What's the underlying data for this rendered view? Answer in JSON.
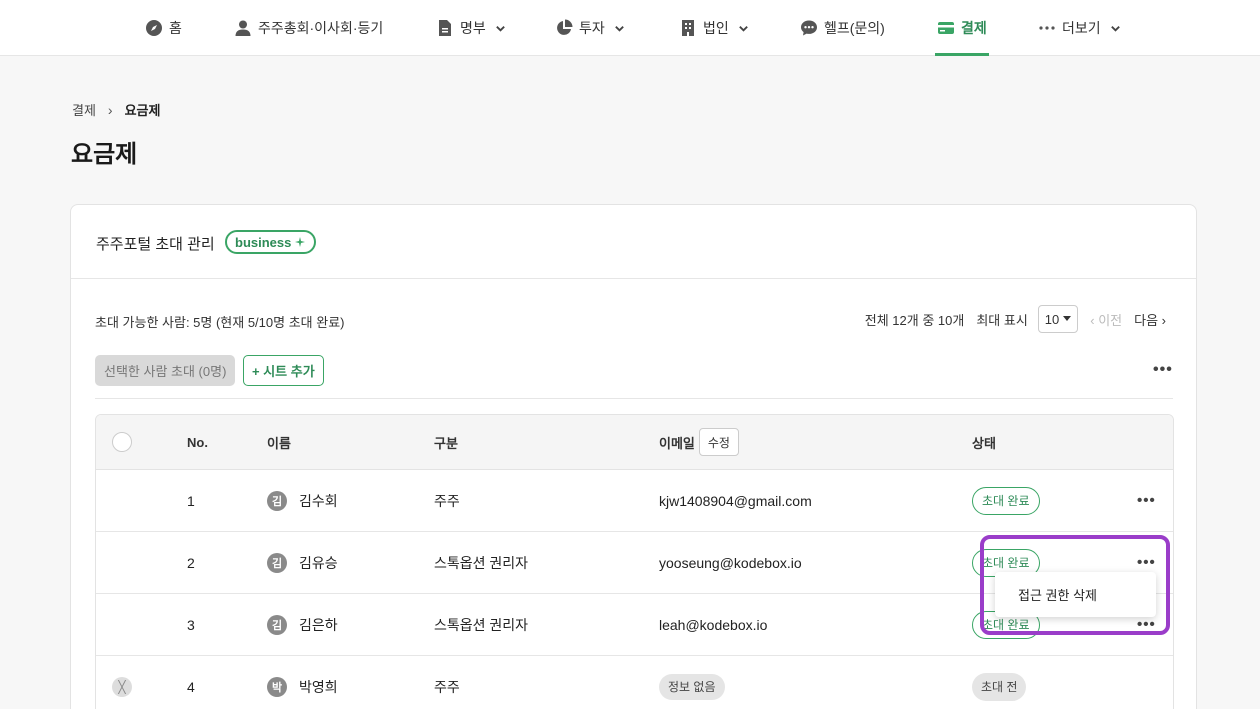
{
  "nav": {
    "items": [
      {
        "label": "홈",
        "icon": "compass-icon"
      },
      {
        "label": "주주총회·이사회·등기",
        "icon": "person-icon"
      },
      {
        "label": "명부",
        "icon": "document-icon"
      },
      {
        "label": "투자",
        "icon": "pie-chart-icon"
      },
      {
        "label": "법인",
        "icon": "building-icon"
      },
      {
        "label": "헬프(문의)",
        "icon": "chat-icon"
      },
      {
        "label": "결제",
        "icon": "card-icon"
      },
      {
        "label": "더보기",
        "icon": "more-dots-icon"
      }
    ],
    "active": "결제",
    "accent_color": "#3aa565"
  },
  "breadcrumb": {
    "parent": "결제",
    "separator": "›",
    "current": "요금제"
  },
  "page_title": "요금제",
  "card": {
    "title": "주주포털 초대 관리",
    "badge": "business"
  },
  "invite_info": "초대 가능한 사람: 5명 (현재 5/10명 초대 완료)",
  "pager": {
    "summary": "전체 12개 중 10개",
    "max_label": "최대 표시",
    "page_size": "10",
    "prev": "‹ 이전",
    "next": "다음 ›"
  },
  "toolbar": {
    "invite_button": "선택한 사람 초대 (0명)",
    "add_sheet_button": "+ 시트 추가",
    "more": "•••"
  },
  "table": {
    "headers": {
      "no": "No.",
      "name": "이름",
      "type": "구분",
      "email": "이메일",
      "edit": "수정",
      "status": "상태"
    },
    "rows": [
      {
        "no": "1",
        "initial": "김",
        "name": "김수회",
        "type": "주주",
        "email": "kjw1408904@gmail.com",
        "status": "초대 완료",
        "more": "•••"
      },
      {
        "no": "2",
        "initial": "김",
        "name": "김유승",
        "type": "스톡옵션 권리자",
        "email": "yooseung@kodebox.io",
        "status": "초대 완료",
        "more": "•••"
      },
      {
        "no": "3",
        "initial": "김",
        "name": "김은하",
        "type": "스톡옵션 권리자",
        "email": "leah@kodebox.io",
        "status": "초대 완료",
        "more": "•••"
      },
      {
        "no": "4",
        "initial": "박",
        "name": "박영희",
        "type": "주주",
        "email": "정보 없음",
        "status": "초대 전",
        "checkbox": "╳"
      }
    ]
  },
  "dropdown": {
    "item": "접근 권한 삭제"
  },
  "highlight_color": "#9a3dc9"
}
